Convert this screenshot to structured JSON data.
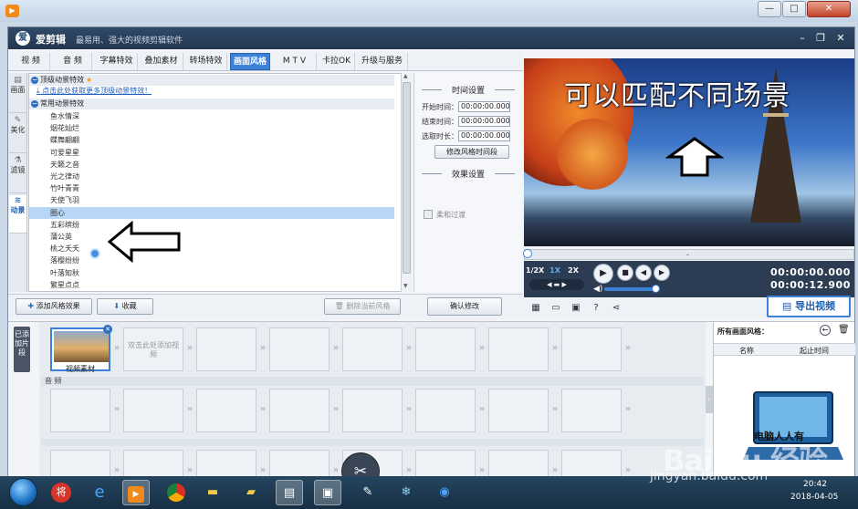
{
  "window": {
    "min_glyph": "—",
    "max_glyph": "□",
    "close_glyph": "✕"
  },
  "app": {
    "name": "爱剪辑",
    "slogan": "最易用、强大的视频剪辑软件",
    "logo_glyph": "爱"
  },
  "tabs": [
    "视 频",
    "音 频",
    "字幕特效",
    "叠加素材",
    "转场特效",
    "画面风格",
    "M T V",
    "卡拉OK",
    "升级与服务"
  ],
  "active_tab": "画面风格",
  "side_tabs": [
    {
      "label": "画面",
      "icon": "▤"
    },
    {
      "label": "美化",
      "icon": "✎"
    },
    {
      "label": "滤镜",
      "icon": "⚗"
    },
    {
      "label": "动景",
      "icon": "≋"
    }
  ],
  "effects": {
    "premium_category": "顶级动景特效",
    "promo_link": "点击此处获取更多顶级动景特效！",
    "common_category": "常用动景特效",
    "items": [
      "鱼水情深",
      "烟花灿烂",
      "蝶舞翩翩",
      "可爱星星",
      "天籁之音",
      "光之律动",
      "竹叶青青",
      "天使飞羽",
      "圈心",
      "五彩缤纷",
      "蒲公英",
      "桃之夭夭",
      "落樱纷纷",
      "叶落知秋",
      "繁星点点"
    ],
    "selected": "圈心"
  },
  "settings": {
    "time_title": "时间设置",
    "start_label": "开始时间：",
    "start_value": "00:00:00.000",
    "end_label": "结束时间：",
    "end_value": "00:00:00.000",
    "sel_label": "选取时长：",
    "sel_value": "00:00:00.000",
    "modify_btn": "修改风格时间段",
    "effect_title": "效果设置",
    "soft_label": "柔和过渡"
  },
  "left_actions": {
    "add": "添加风格效果",
    "collect": "收藏",
    "delete": "删除当前风格",
    "confirm": "确认修改"
  },
  "preview": {
    "caption": "可以匹配不同场景"
  },
  "player": {
    "speeds": [
      "1/2X",
      "1X",
      "2X"
    ],
    "active_speed": "1X",
    "current_time": "00:00:00.000",
    "total_time": "00:00:12.900",
    "volume": 0.78,
    "progress": 0.0
  },
  "export_label": "导出视频",
  "timeline": {
    "added_label": "已添加片段",
    "first_clip_caption": "视频素材",
    "add_hint": "双击此处添加视频",
    "audio_label": "音 频"
  },
  "style_panel": {
    "title": "所有画面风格：",
    "col_name": "名称",
    "col_start": "起止时间",
    "logo_text": "电脑人人有"
  },
  "taskbar": {
    "time": "20:42",
    "date": "2018-04-05"
  },
  "watermark": {
    "brand": "Bai du 经验",
    "url": "jingyan.baidu.com"
  }
}
